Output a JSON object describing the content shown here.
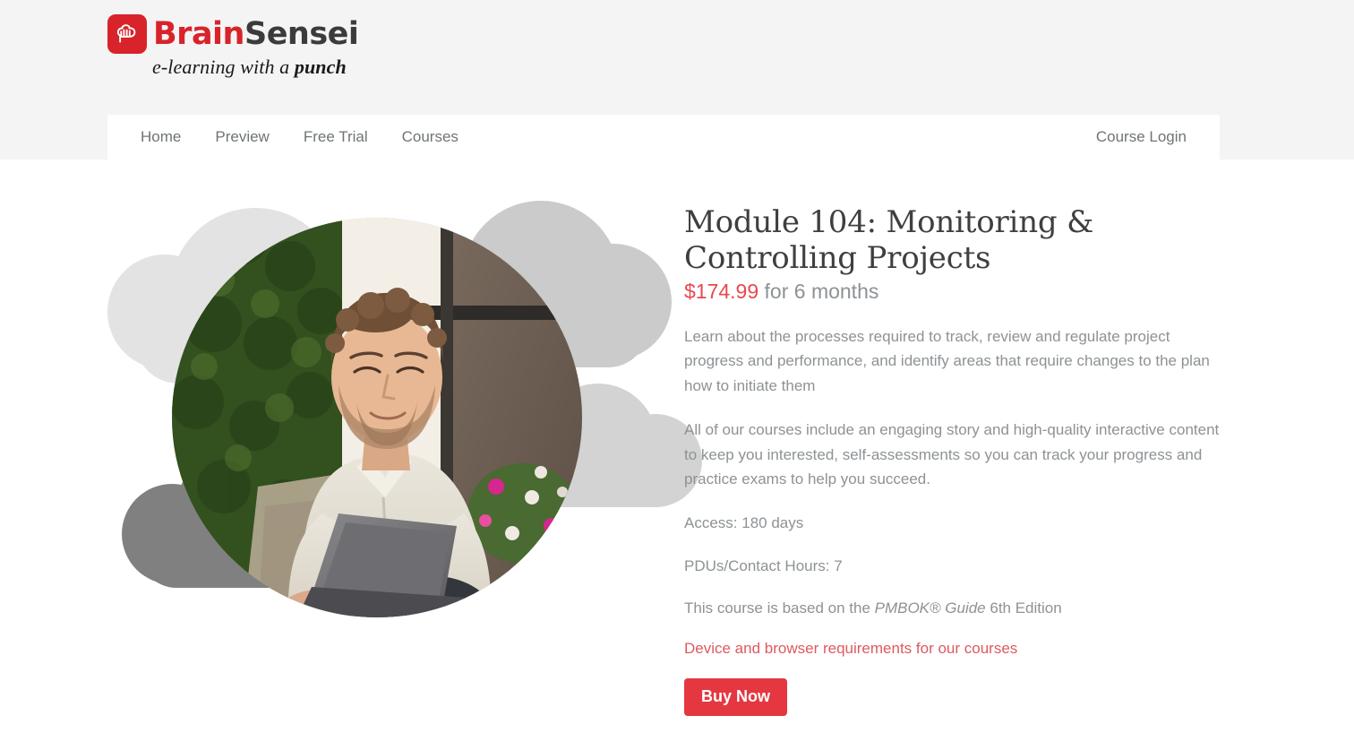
{
  "brand": {
    "name_part_1": "Brain",
    "name_part_2": "Sensei",
    "tagline_prefix": "e-learning with a ",
    "tagline_emphasis": "punch",
    "logo_icon": "brain-icon",
    "accent_red": "#d8232a"
  },
  "nav": {
    "items": [
      {
        "label": "Home"
      },
      {
        "label": "Preview"
      },
      {
        "label": "Free Trial"
      },
      {
        "label": "Courses"
      }
    ],
    "login_label": "Course Login"
  },
  "media": {
    "photo_alt": "Man sitting outdoors working on a laptop",
    "cloud_colors": [
      "#e2e3e2",
      "#cacbca",
      "#d2d3d2",
      "#808080"
    ]
  },
  "course": {
    "title": "Module 104: Monitoring & Controlling Projects",
    "price": "$174.99",
    "price_period": "for 6 months",
    "description": "Learn about the processes required to track, review and regulate project progress and performance, and identify areas that require changes to the plan how to initiate them",
    "features": "All of our courses include an engaging story and high-quality interactive content to keep you interested, self-assessments so you can track your progress and practice exams to help you succeed.",
    "access": "Access: 180 days",
    "pdus": "PDUs/Contact Hours: 7",
    "based_on_prefix": "This course is based on the ",
    "based_on_italic": "PMBOK® Guide",
    "based_on_suffix": " 6th Edition",
    "requirements_link": "Device and browser requirements for our courses",
    "buy_label": "Buy Now",
    "price_color": "#e8484f",
    "button_color": "#e53740"
  }
}
